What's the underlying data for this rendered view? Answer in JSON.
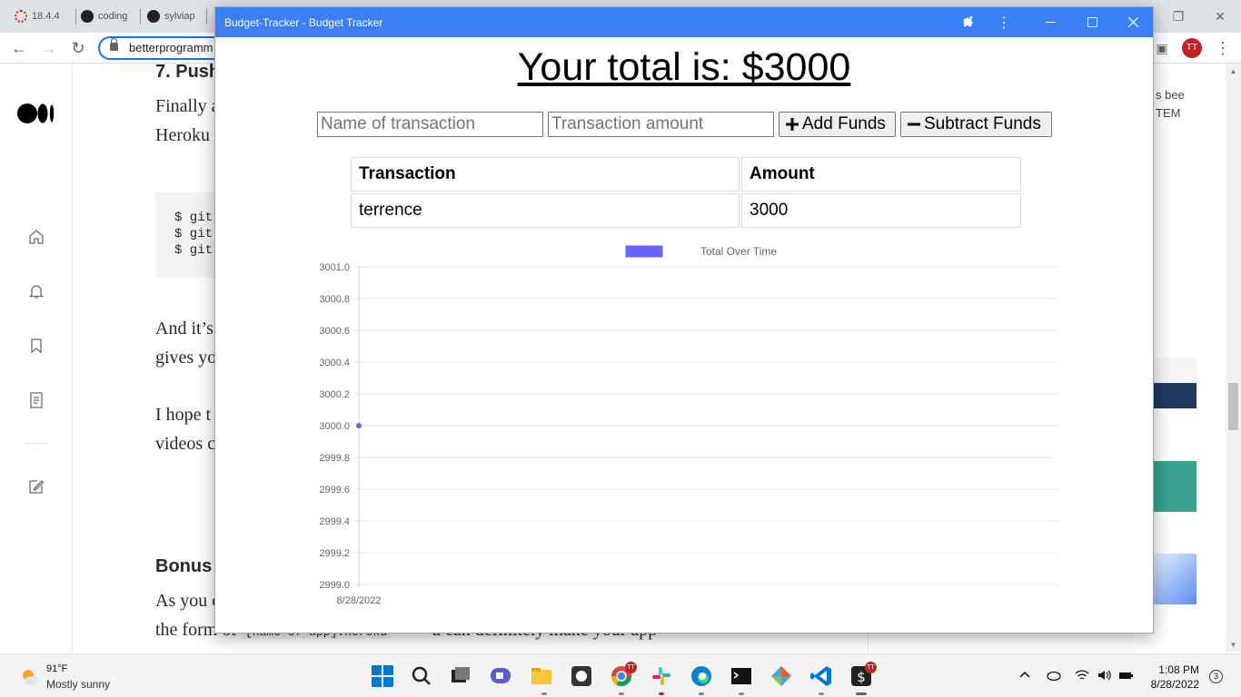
{
  "browser": {
    "tabs": [
      {
        "label": "18.4.4"
      },
      {
        "label": "coding"
      },
      {
        "label": "sylviap"
      }
    ],
    "url": "betterprogramm",
    "avatar_initials": "TT"
  },
  "article": {
    "heading_push": "7. Push",
    "line_finally": "Finally a",
    "line_heroku": "Heroku",
    "code_lines": [
      "$ git",
      "$ git",
      "$ git"
    ],
    "line_and_its": "And it’s",
    "line_gives": "gives yo",
    "line_hope": "I hope t",
    "line_videos": "videos c",
    "heading_bonus": "Bonus",
    "line_as_you": "As you c",
    "line_form": "the form of",
    "line_form_code": "[name-of-app].heroku",
    "line_form_end": "u can definitely make your app",
    "right_snip_1": "s bee",
    "right_snip_2": "TEM"
  },
  "app": {
    "window_title": "Budget-Tracker - Budget Tracker",
    "total_heading": "Your total is: $3000",
    "name_placeholder": "Name of transaction",
    "amount_placeholder": "Transaction amount",
    "add_button_label": "Add Funds",
    "subtract_button_label": "Subtract Funds",
    "table": {
      "headers": [
        "Transaction",
        "Amount"
      ],
      "rows": [
        [
          "terrence",
          "3000"
        ]
      ]
    }
  },
  "chart_data": {
    "type": "line",
    "title": "",
    "xlabel": "",
    "ylabel": "",
    "categories": [
      "8/28/2022"
    ],
    "series": [
      {
        "name": "Total Over Time",
        "values": [
          3000
        ],
        "color": "#6666ff"
      }
    ],
    "ylim": [
      2999.0,
      3001.0
    ],
    "yticks": [
      "3001.0",
      "3000.8",
      "3000.6",
      "3000.4",
      "3000.2",
      "3000.0",
      "2999.8",
      "2999.6",
      "2999.4",
      "2999.2",
      "2999.0"
    ],
    "legend": "top-center",
    "grid": true
  },
  "taskbar": {
    "weather_temp": "91°F",
    "weather_desc": "Mostly sunny",
    "time": "1:08 PM",
    "date": "8/28/2022",
    "notification_count": "3",
    "badge_tt": "TT"
  },
  "colors": {
    "titlebar": "#3a7ff6",
    "series": "#6666ff",
    "avatar": "#c5221f"
  }
}
